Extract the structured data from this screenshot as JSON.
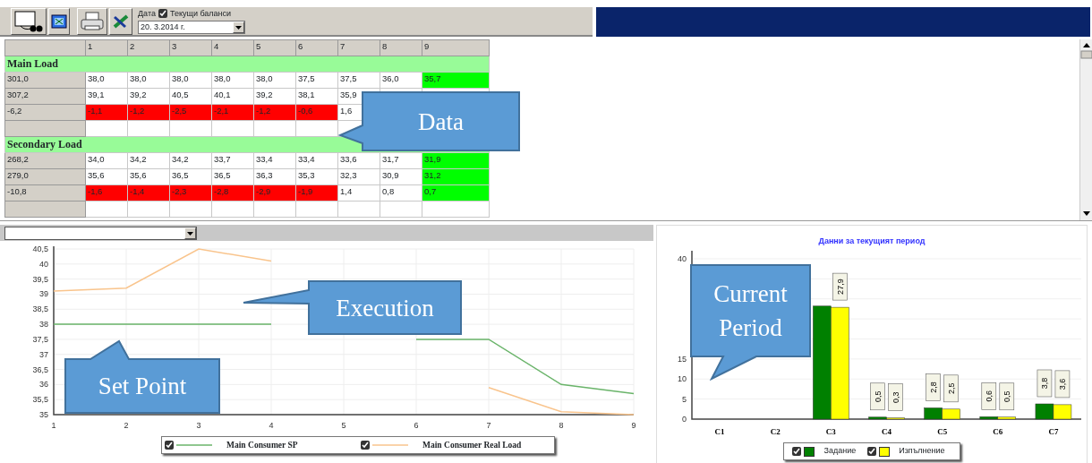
{
  "toolbar": {
    "buttons": [
      {
        "kind": "monitor"
      },
      {
        "kind": "window"
      },
      {
        "kind": "printer"
      },
      {
        "kind": "tools"
      }
    ],
    "date_label": "Дата",
    "current_balances": {
      "label": "Текущи баланси",
      "checked": true
    },
    "date": "20.  3.2014 г."
  },
  "table": {
    "columns": [
      "1",
      "2",
      "3",
      "4",
      "5",
      "6",
      "7",
      "8",
      "9"
    ],
    "sections": [
      {
        "title": "Main Load",
        "rows": [
          {
            "kind": "values",
            "label": "301,0",
            "cells": [
              {
                "text": "38,0",
                "color": "#ffffff"
              },
              {
                "text": "38,0",
                "color": "#ffffff"
              },
              {
                "text": "38,0",
                "color": "#ffffff"
              },
              {
                "text": "38,0",
                "color": "#ffffff"
              },
              {
                "text": "38,0",
                "color": "#ffffff"
              },
              {
                "text": "37,5",
                "color": "#ffffff"
              },
              {
                "text": "37,5",
                "color": "#ffffff"
              },
              {
                "text": "36,0",
                "color": "#ffffff"
              },
              {
                "text": "35,7",
                "color": "#00ff00"
              }
            ]
          },
          {
            "kind": "values",
            "label": "307,2",
            "cells": [
              {
                "text": "39,1",
                "color": "#ffffff"
              },
              {
                "text": "39,2",
                "color": "#ffffff"
              },
              {
                "text": "40,5",
                "color": "#ffffff"
              },
              {
                "text": "40,1",
                "color": "#ffffff"
              },
              {
                "text": "39,2",
                "color": "#ffffff"
              },
              {
                "text": "38,1",
                "color": "#ffffff"
              },
              {
                "text": "35,9",
                "color": "#ffffff"
              }
            ]
          },
          {
            "kind": "values",
            "label": "-6,2",
            "cells": [
              {
                "text": "-1,1",
                "color": "#ff0000"
              },
              {
                "text": "-1,2",
                "color": "#ff0000"
              },
              {
                "text": "-2,5",
                "color": "#ff0000"
              },
              {
                "text": "-2,1",
                "color": "#ff0000"
              },
              {
                "text": "-1,2",
                "color": "#ff0000"
              },
              {
                "text": "-0,6",
                "color": "#ff0000"
              },
              {
                "text": "1,6",
                "color": "#ffffff"
              }
            ]
          },
          {
            "kind": "blank"
          }
        ]
      },
      {
        "title": "Secondary Load",
        "rows": [
          {
            "kind": "values",
            "label": "268,2",
            "cells": [
              {
                "text": "34,0",
                "color": "#ffffff"
              },
              {
                "text": "34,2",
                "color": "#ffffff"
              },
              {
                "text": "34,2",
                "color": "#ffffff"
              },
              {
                "text": "33,7",
                "color": "#ffffff"
              },
              {
                "text": "33,4",
                "color": "#ffffff"
              },
              {
                "text": "33,4",
                "color": "#ffffff"
              },
              {
                "text": "33,6",
                "color": "#ffffff"
              },
              {
                "text": "31,7",
                "color": "#ffffff"
              },
              {
                "text": "31,9",
                "color": "#00ff00"
              }
            ]
          },
          {
            "kind": "values",
            "label": "279,0",
            "cells": [
              {
                "text": "35,6",
                "color": "#ffffff"
              },
              {
                "text": "35,6",
                "color": "#ffffff"
              },
              {
                "text": "36,5",
                "color": "#ffffff"
              },
              {
                "text": "36,5",
                "color": "#ffffff"
              },
              {
                "text": "36,3",
                "color": "#ffffff"
              },
              {
                "text": "35,3",
                "color": "#ffffff"
              },
              {
                "text": "32,3",
                "color": "#ffffff"
              },
              {
                "text": "30,9",
                "color": "#ffffff"
              },
              {
                "text": "31,2",
                "color": "#00ff00"
              }
            ]
          },
          {
            "kind": "values",
            "label": "-10,8",
            "cells": [
              {
                "text": "-1,6",
                "color": "#ff0000"
              },
              {
                "text": "-1,4",
                "color": "#ff0000"
              },
              {
                "text": "-2,3",
                "color": "#ff0000"
              },
              {
                "text": "-2,8",
                "color": "#ff0000"
              },
              {
                "text": "-2,9",
                "color": "#ff0000"
              },
              {
                "text": "-1,9",
                "color": "#ff0000"
              },
              {
                "text": "1,4",
                "color": "#ffffff"
              },
              {
                "text": "0,8",
                "color": "#ffffff"
              },
              {
                "text": "0,7",
                "color": "#00ff00"
              }
            ]
          },
          {
            "kind": "blank"
          }
        ]
      }
    ]
  },
  "line_panel": {
    "chart_data": {
      "type": "line",
      "x": [
        1,
        2,
        3,
        4,
        5,
        6,
        7,
        8,
        9
      ],
      "xticks": [
        1,
        2,
        3,
        4,
        5,
        6,
        7,
        8,
        9
      ],
      "xlim": [
        1,
        9
      ],
      "ylim": [
        35,
        40.5
      ],
      "yticks": [
        {
          "value": 35,
          "label": "35"
        },
        {
          "value": 35.5,
          "label": "35,5"
        },
        {
          "value": 36,
          "label": "36"
        },
        {
          "value": 36.5,
          "label": "36,5"
        },
        {
          "value": 37,
          "label": "37"
        },
        {
          "value": 37.5,
          "label": "37,5"
        },
        {
          "value": 38,
          "label": "38"
        },
        {
          "value": 38.5,
          "label": "38,5"
        },
        {
          "value": 39,
          "label": "39"
        },
        {
          "value": 39.5,
          "label": "39,5"
        },
        {
          "value": 40,
          "label": "40"
        },
        {
          "value": 40.5,
          "label": "40,5"
        }
      ],
      "series": [
        {
          "name": "Main Consumer SP",
          "color": "#6ab46a",
          "values": [
            38,
            38,
            38,
            38,
            null,
            37.5,
            37.5,
            36,
            35.7
          ]
        },
        {
          "name": "Main Consumer Real Load",
          "color": "#f9c48c",
          "values": [
            39.1,
            39.2,
            40.5,
            40.1,
            null,
            null,
            35.9,
            35.1,
            35
          ]
        }
      ],
      "grid": true
    },
    "legend": [
      {
        "checked": true
      },
      {
        "checked": true
      }
    ]
  },
  "bar_panel": {
    "chart_data": {
      "type": "bar",
      "title": "Данни за текущият период",
      "categories": [
        "C1",
        "C2",
        "C3",
        "C4",
        "C5",
        "C6",
        "C7"
      ],
      "ylim": [
        0,
        42
      ],
      "yticks": [
        0,
        5,
        10,
        15,
        40
      ],
      "series": [
        {
          "name": "Задание",
          "color": "#008000",
          "values": [
            null,
            null,
            28.2,
            0.5,
            2.8,
            0.6,
            3.8
          ]
        },
        {
          "name": "Изпълнение",
          "color": "#ffff00",
          "values": [
            null,
            null,
            27.9,
            0.3,
            2.5,
            0.5,
            3.6
          ]
        }
      ],
      "grid": true,
      "value_labels": [
        [
          null,
          null,
          null,
          "0,5",
          "2,8",
          "0,6",
          "3,8"
        ],
        [
          null,
          null,
          "27,9",
          "0,3",
          "2,5",
          "0,5",
          "3,6"
        ]
      ]
    },
    "legend": [
      {
        "checked": true
      },
      {
        "checked": true
      }
    ]
  },
  "callouts": [
    {
      "text": "Data"
    },
    {
      "text": "Execution"
    },
    {
      "text": "Set Point"
    },
    {
      "text": "Current Period"
    }
  ]
}
